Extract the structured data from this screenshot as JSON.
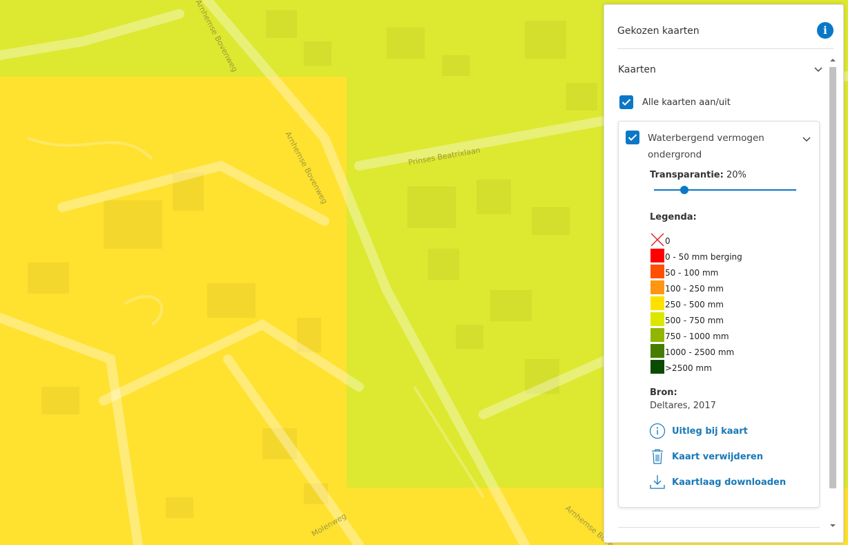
{
  "map": {
    "colors": {
      "green_yellow": "#dde830",
      "yellow": "#ffe130"
    },
    "streets": [
      {
        "id": "arnhemse-bovenweg-top",
        "text": "Arnhemse Bovenweg"
      },
      {
        "id": "arnhemse-bovenweg-mid",
        "text": "Arnhemse Bovenweg"
      },
      {
        "id": "prinses-beatrixlaan",
        "text": "Prinses Beatrixlaan"
      },
      {
        "id": "molenweg",
        "text": "Molenweg"
      },
      {
        "id": "arnhemse-bovenweg-bottom",
        "text": "Arnhemse Bovenweg"
      }
    ]
  },
  "panel": {
    "title": "Gekozen kaarten",
    "info_icon": "info-icon",
    "section_label": "Kaarten",
    "all_toggle_label": "Alle kaarten aan/uit",
    "all_toggle_checked": true,
    "layer": {
      "title": "Waterbergend vermogen ondergrond",
      "checked": true,
      "transparency_label": "Transparantie",
      "transparency_separator": ":",
      "transparency_value": "20%",
      "transparency_fraction": 0.2,
      "legend_title": "Legenda:",
      "legend": [
        {
          "label": "0",
          "color": "none",
          "icon": "cross-icon"
        },
        {
          "label": "0 - 50 mm berging",
          "color": "#ff0000"
        },
        {
          "label": "50 - 100 mm",
          "color": "#ff5000"
        },
        {
          "label": "100 - 250 mm",
          "color": "#ff9612"
        },
        {
          "label": "250 - 500 mm",
          "color": "#ffe100"
        },
        {
          "label": "500 - 750 mm",
          "color": "#dce700"
        },
        {
          "label": "750 - 1000 mm",
          "color": "#91b600"
        },
        {
          "label": "1000 - 2500 mm",
          "color": "#467d00"
        },
        {
          "label": ">2500 mm",
          "color": "#0a4b00"
        }
      ],
      "source_title": "Bron:",
      "source_value": "Deltares, 2017",
      "actions": {
        "explain": "Uitleg bij kaart",
        "remove": "Kaart verwijderen",
        "download": "Kaartlaag downloaden"
      }
    }
  }
}
